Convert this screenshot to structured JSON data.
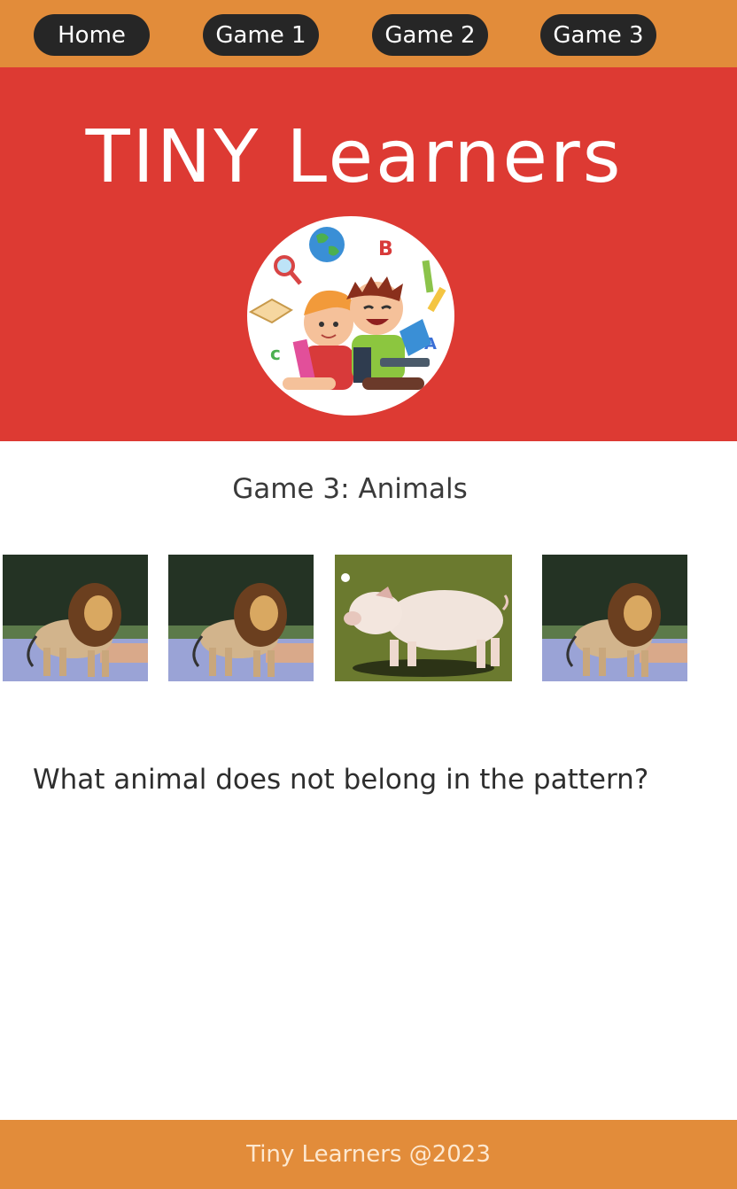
{
  "nav": {
    "items": [
      {
        "label": "Home"
      },
      {
        "label": "Game 1"
      },
      {
        "label": "Game 2"
      },
      {
        "label": "Game 3"
      }
    ]
  },
  "hero": {
    "title": "TINY Learners",
    "logo_icon": "kids-learning-logo-icon"
  },
  "game": {
    "title": "Game 3: Animals",
    "options": [
      {
        "animal": "lion-icon"
      },
      {
        "animal": "lion-icon"
      },
      {
        "animal": "pig-icon"
      },
      {
        "animal": "lion-icon"
      }
    ],
    "question": "What animal does not belong in the pattern?"
  },
  "footer": {
    "text": "Tiny Learners @2023"
  },
  "colors": {
    "nav_bg": "#e28c3a",
    "hero_bg": "#dd3a33",
    "nav_button_bg": "#262626",
    "footer_bg": "#e28c3a"
  }
}
